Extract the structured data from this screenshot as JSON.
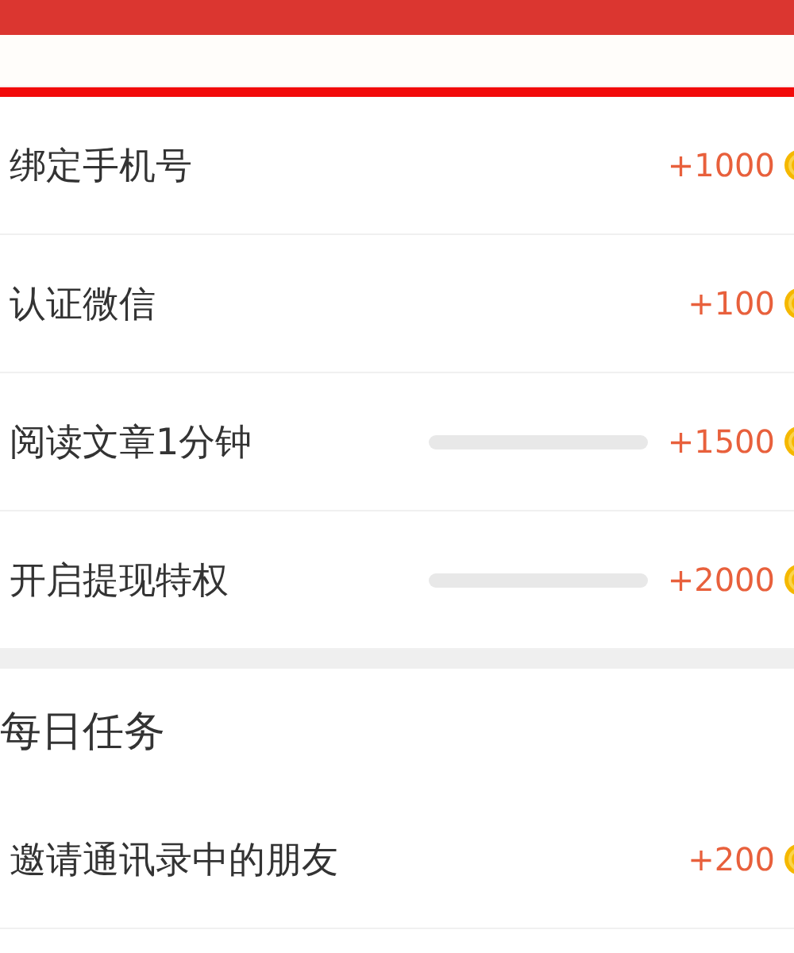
{
  "sections": [
    {
      "tasks": [
        {
          "label": "绑定手机号",
          "reward": "+1000",
          "kind": "plain"
        },
        {
          "label": "认证微信",
          "reward": "+100",
          "kind": "plain"
        },
        {
          "label": "阅读文章1分钟",
          "reward": "+1500",
          "kind": "progress",
          "level": 0
        },
        {
          "label": "开启提现特权",
          "reward": "+2000",
          "kind": "progress",
          "level": 0
        }
      ]
    },
    {
      "title": "每日任务",
      "tasks": [
        {
          "label": "邀请通讯录中的朋友",
          "reward": "+200",
          "kind": "plain"
        }
      ]
    }
  ]
}
